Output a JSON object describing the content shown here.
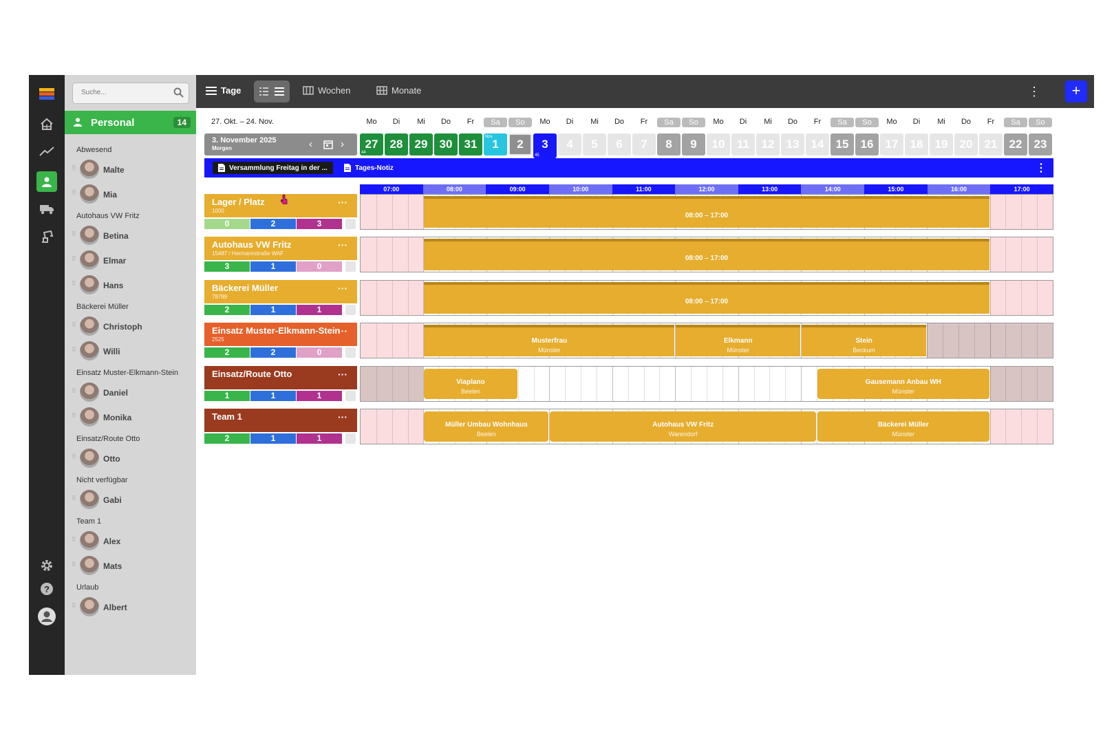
{
  "search": {
    "placeholder": "Suche..."
  },
  "personal": {
    "title": "Personal",
    "count": "14"
  },
  "groups": [
    {
      "label": "Abwesend",
      "members": [
        "Malte",
        "Mia"
      ]
    },
    {
      "label": "Autohaus VW Fritz",
      "members": [
        "Betina",
        "Elmar",
        "Hans"
      ]
    },
    {
      "label": "Bäckerei Müller",
      "members": [
        "Christoph",
        "Willi"
      ]
    },
    {
      "label": "Einsatz Muster-Elkmann-Stein",
      "members": [
        "Daniel",
        "Monika"
      ]
    },
    {
      "label": "Einsatz/Route Otto",
      "members": [
        "Otto"
      ]
    },
    {
      "label": "Nicht verfügbar",
      "members": [
        "Gabi"
      ]
    },
    {
      "label": "Team 1",
      "members": [
        "Alex",
        "Mats"
      ]
    },
    {
      "label": "Urlaub",
      "members": [
        "Albert"
      ]
    }
  ],
  "topbar": {
    "tage": "Tage",
    "wochen": "Wochen",
    "monate": "Monate"
  },
  "calendar": {
    "range": "27. Okt. – 24. Nov.",
    "current_date": "3. November 2025",
    "current_sub": "Morgen",
    "weekdays": [
      "Mo",
      "Di",
      "Mi",
      "Do",
      "Fr",
      "Sa",
      "So",
      "Mo",
      "Di",
      "Mi",
      "Do",
      "Fr",
      "Sa",
      "So",
      "Mo",
      "Di",
      "Mi",
      "Do",
      "Fr",
      "Sa",
      "So",
      "Mo",
      "Di",
      "Mi",
      "Do",
      "Fr",
      "Sa",
      "So"
    ],
    "days": [
      "27",
      "28",
      "29",
      "30",
      "31",
      "1",
      "2",
      "3",
      "4",
      "5",
      "6",
      "7",
      "8",
      "9",
      "10",
      "11",
      "12",
      "13",
      "14",
      "15",
      "16",
      "17",
      "18",
      "19",
      "20",
      "21",
      "22",
      "23"
    ],
    "week_44": "44",
    "week_45": "45",
    "month_nov": "Nov."
  },
  "notes": {
    "note1": "Versammlung Freitag in der ...",
    "note2": "Tages-Notiz"
  },
  "hours": [
    "07:00",
    "08:00",
    "09:00",
    "10:00",
    "11:00",
    "12:00",
    "13:00",
    "14:00",
    "15:00",
    "16:00",
    "17:00"
  ],
  "colors": {
    "green": "#39b54a",
    "blue_counter": "#2f6fdb",
    "magenta": "#b0318e",
    "amber": "#e6ad2e",
    "orange": "#e5602a",
    "brown": "#9a3a1f",
    "deep_blue": "#1616ff"
  },
  "rows": [
    {
      "title": "Lager / Platz",
      "sub": "1000",
      "c1": "0",
      "c2": "2",
      "c3": "3",
      "blocks": [
        {
          "l1": "08:00 – 17:00"
        }
      ]
    },
    {
      "title": "Autohaus VW Fritz",
      "sub": "15487 / Hermannstraße WAF",
      "c1": "3",
      "c2": "1",
      "c3": "0",
      "blocks": [
        {
          "l1": "08:00 – 17:00"
        }
      ]
    },
    {
      "title": "Bäckerei Müller",
      "sub": "78789",
      "c1": "2",
      "c2": "1",
      "c3": "1",
      "blocks": [
        {
          "l1": "08:00 – 17:00"
        }
      ]
    },
    {
      "title": "Einsatz Muster-Elkmann-Stein",
      "sub": "2525",
      "c1": "2",
      "c2": "2",
      "c3": "0",
      "blocks": [
        {
          "l1": "Musterfrau",
          "l2": "Münster"
        },
        {
          "l1": "Elkmann",
          "l2": "Münster"
        },
        {
          "l1": "Stein",
          "l2": "Beckum"
        }
      ]
    },
    {
      "title": "Einsatz/Route Otto",
      "sub": "",
      "c1": "1",
      "c2": "1",
      "c3": "1",
      "blocks": [
        {
          "l1": "Viaplano",
          "l2": "Beelen"
        },
        {
          "l1": "Gausemann Anbau WH",
          "l2": "Münster"
        }
      ]
    },
    {
      "title": "Team 1",
      "sub": "",
      "c1": "2",
      "c2": "1",
      "c3": "1",
      "blocks": [
        {
          "l1": "Müller Umbau Wohnhaus",
          "l2": "Beelen"
        },
        {
          "l1": "Autohaus VW Fritz",
          "l2": "Warendorf"
        },
        {
          "l1": "Bäckerei Müller",
          "l2": "Münster"
        }
      ]
    }
  ]
}
